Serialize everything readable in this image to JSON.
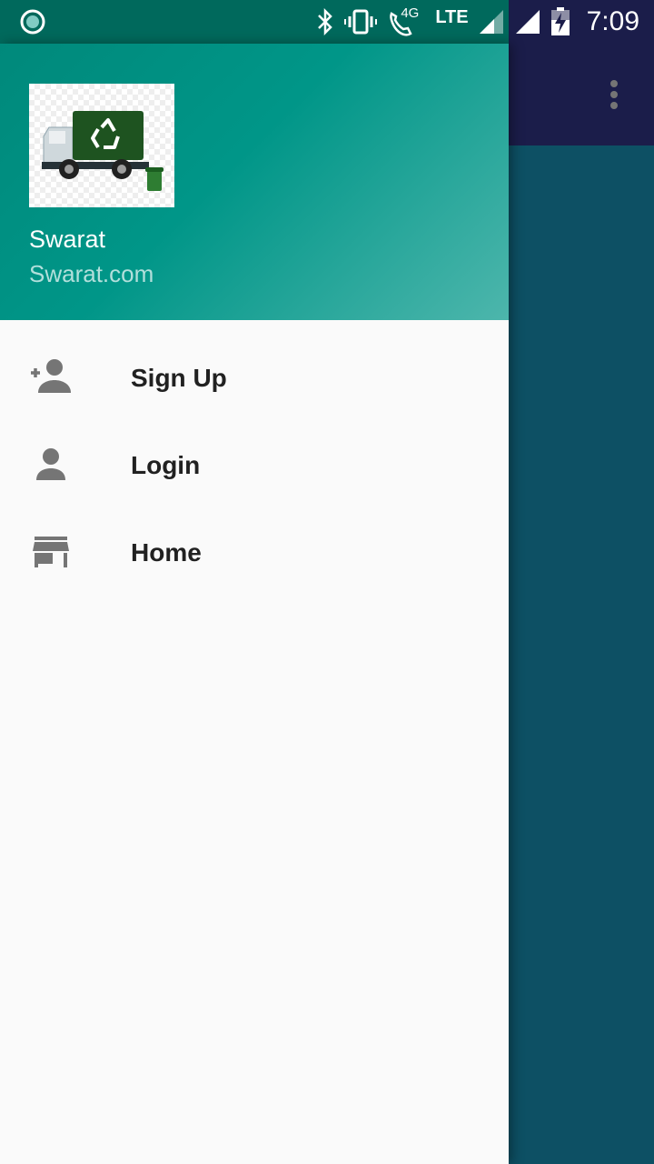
{
  "status_bar": {
    "time": "7:09",
    "network_label": "4G",
    "lte_label": "LTE",
    "icons": [
      "app-notification-icon",
      "bluetooth-icon",
      "vibrate-icon",
      "wifi-call-icon",
      "signal-icon",
      "signal-icon",
      "battery-charging-icon"
    ]
  },
  "app_bar": {
    "overflow_icon": "more-vert-icon"
  },
  "drawer": {
    "header": {
      "logo_icon": "recycling-truck-logo",
      "name": "Swarat",
      "website": "Swarat.com"
    },
    "items": [
      {
        "label": "Sign Up",
        "icon": "person-add-icon"
      },
      {
        "label": "Login",
        "icon": "person-icon"
      },
      {
        "label": "Home",
        "icon": "store-icon"
      }
    ]
  },
  "colors": {
    "header_gradient_start": "#00897b",
    "header_gradient_end": "#4db6ac",
    "app_toolbar": "#1b1d4a",
    "app_background": "#0d5064",
    "drawer_background": "#fafafa",
    "menu_icon": "#757575",
    "menu_text": "#212121"
  }
}
